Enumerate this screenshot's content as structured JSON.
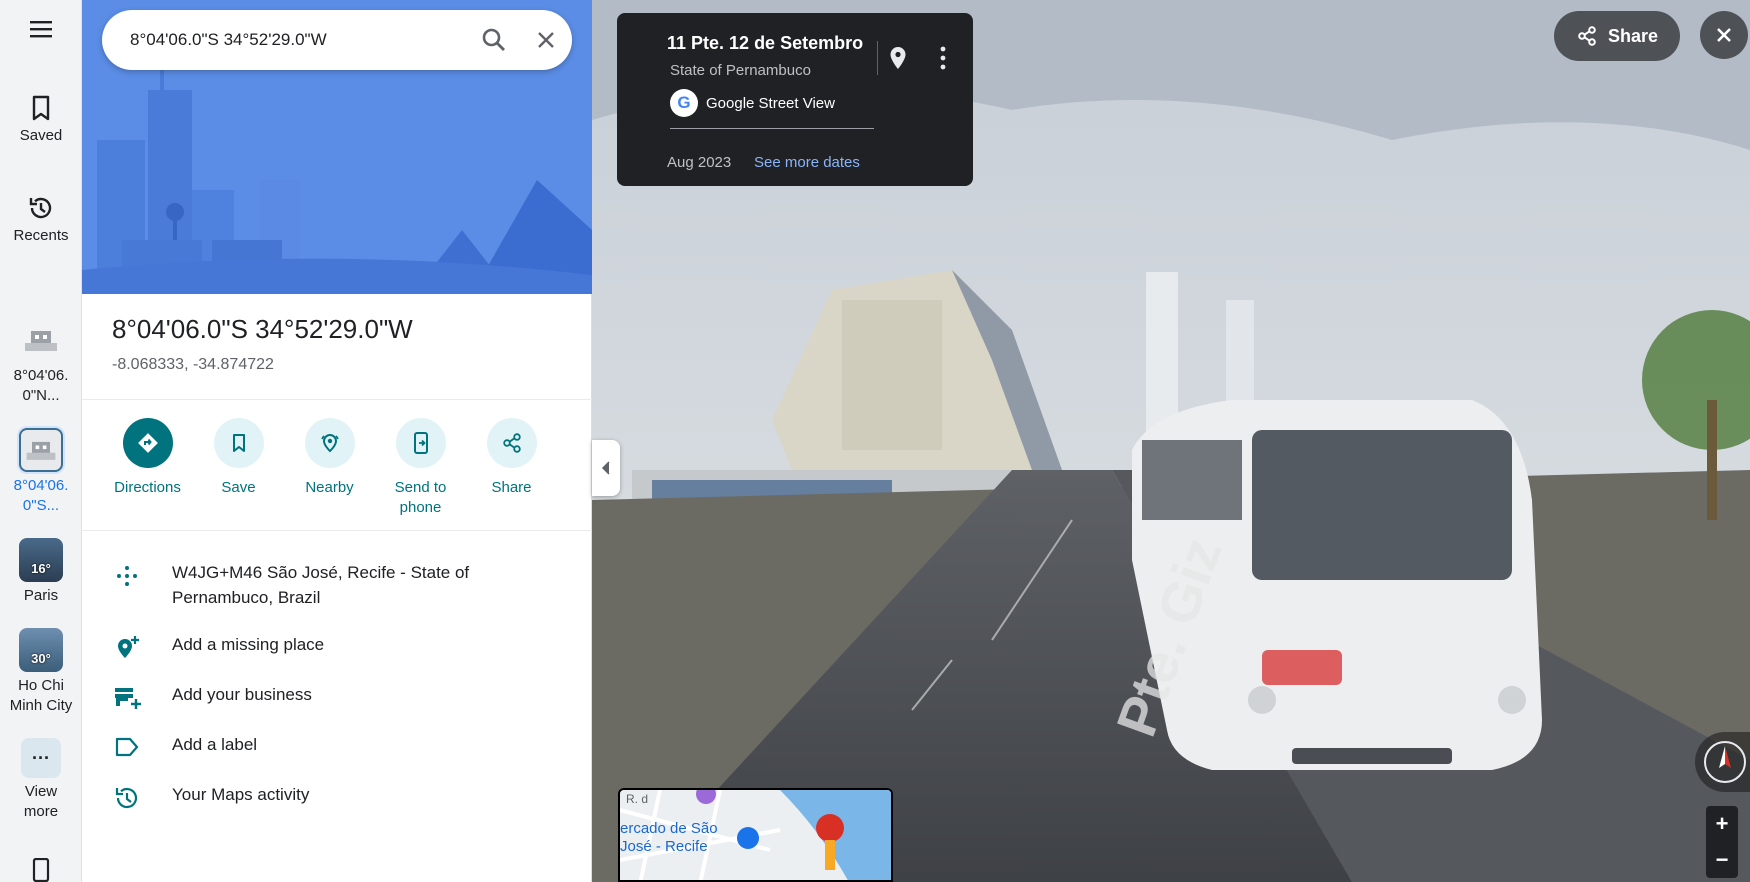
{
  "search": {
    "value": "8°04'06.0\"S 34°52'29.0\"W"
  },
  "rail": {
    "saved_label": "Saved",
    "recents_label": "Recents",
    "history": [
      {
        "label": "8°04'06.\n0\"N..."
      },
      {
        "label": "8°04'06.\n0\"S..."
      },
      {
        "label": "Paris",
        "badge": "16°"
      },
      {
        "label": "Ho Chi\nMinh City",
        "badge": "30°"
      }
    ],
    "view_more_label": "View\nmore"
  },
  "place": {
    "title": "8°04'06.0\"S 34°52'29.0\"W",
    "coords": "-8.068333, -34.874722"
  },
  "actions": [
    {
      "label": "Directions",
      "icon": "directions-icon"
    },
    {
      "label": "Save",
      "icon": "bookmark-icon"
    },
    {
      "label": "Nearby",
      "icon": "nearby-icon"
    },
    {
      "label": "Send to\nphone",
      "icon": "send-to-phone-icon"
    },
    {
      "label": "Share",
      "icon": "share-icon"
    }
  ],
  "info": [
    {
      "text": "W4JG+M46 São José, Recife - State of Pernambuco, Brazil",
      "icon": "plus-code-icon"
    },
    {
      "text": "Add a missing place",
      "icon": "add-place-icon"
    },
    {
      "text": "Add your business",
      "icon": "add-business-icon"
    },
    {
      "text": "Add a label",
      "icon": "label-icon"
    },
    {
      "text": "Your Maps activity",
      "icon": "history-icon"
    }
  ],
  "streetview": {
    "title": "11 Pte. 12 de Setembro",
    "region": "State of Pernambuco",
    "provider": "Google Street View",
    "date": "Aug 2023",
    "see_more": "See more dates",
    "share_label": "Share",
    "minimap_label": "ercado de São\nJosé - Recife",
    "minimap_road": "R. d"
  },
  "colors": {
    "accent": "#00737e",
    "hero": "#4f86e3",
    "card": "#202124",
    "link": "#8ab4f8"
  }
}
